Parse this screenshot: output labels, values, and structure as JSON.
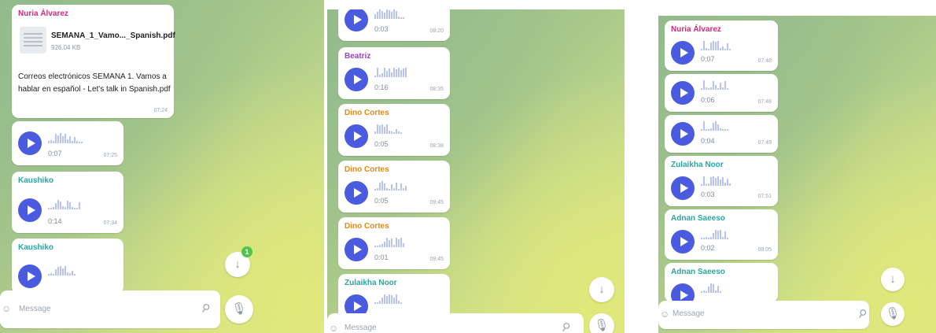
{
  "colors": {
    "accent": "#4a5bdf",
    "badge": "#4fc64a"
  },
  "panel1": {
    "doc": {
      "sender": "Nuria Álvarez",
      "sender_color": "#d7267c",
      "file_name": "SEMANA_1_Vamo..._Spanish.pdf",
      "file_size": "926.04 KB",
      "caption": "Correos electrónicos SEMANA 1. Vamos a hablar en español - Let's talk in Spanish.pdf",
      "time": "07:24"
    },
    "voice1": {
      "duration": "0:07",
      "time": "07:25"
    },
    "voice2": {
      "sender": "Kaushiko",
      "sender_color": "#2aa6a1",
      "duration": "0:14",
      "time": "07:34"
    },
    "voice3": {
      "sender": "Kaushiko",
      "sender_color": "#2aa6a1"
    },
    "badge_count": "1",
    "input_placeholder": "Message",
    "icons": {
      "scroll_down": "arrow-down-icon",
      "mic": "microphone-icon",
      "attach": "paperclip-icon",
      "emoji": "emoji-icon"
    }
  },
  "panel2": {
    "voice0": {
      "duration": "0:03",
      "time": "08:20"
    },
    "voice1": {
      "sender": "Beatriz",
      "sender_color": "#9b3fc6",
      "duration": "0:16",
      "time": "08:35"
    },
    "voice2": {
      "sender": "Dino Cortes",
      "sender_color": "#e8870f",
      "duration": "0:05",
      "time": "08:38"
    },
    "voice3": {
      "sender": "Dino Cortes",
      "sender_color": "#e8870f",
      "duration": "0:05",
      "time": "09:45"
    },
    "voice4": {
      "sender": "Dino Cortes",
      "sender_color": "#e8870f",
      "duration": "0:01",
      "time": "09:45"
    },
    "voice5": {
      "sender": "Zulaikha Noor",
      "sender_color": "#2aa6a1"
    },
    "input_placeholder": "Message"
  },
  "panel3": {
    "voice1": {
      "sender": "Nuria Álvarez",
      "sender_color": "#d7267c",
      "duration": "0:07",
      "time": "07:48"
    },
    "voice2": {
      "duration": "0:06",
      "time": "07:48"
    },
    "voice3": {
      "duration": "0:04",
      "time": "07:49"
    },
    "voice4": {
      "sender": "Zulaikha Noor",
      "sender_color": "#2aa6a1",
      "duration": "0:03",
      "time": "07:51"
    },
    "voice5": {
      "sender": "Adnan Saeeso",
      "sender_color": "#2aa6a1",
      "duration": "0:02",
      "time": "08:05"
    },
    "voice6": {
      "sender": "Adnan Saeeso",
      "sender_color": "#2aa6a1"
    },
    "input_placeholder": "Message"
  }
}
